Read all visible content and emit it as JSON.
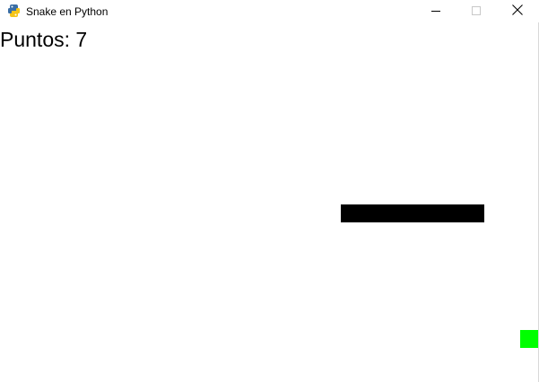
{
  "window": {
    "title": "Snake en Python",
    "icons": {
      "app": "python-icon",
      "minimize": "minimize-icon",
      "maximize": "maximize-icon",
      "close": "close-icon"
    }
  },
  "game": {
    "score_text": "Puntos: 7",
    "score": 7,
    "grid_cell": 20,
    "colors": {
      "background": "#ffffff",
      "snake": "#000000",
      "food": "#00ff00",
      "text": "#000000"
    },
    "snake_length": 8,
    "snake_direction": "horizontal",
    "food_present": true
  }
}
